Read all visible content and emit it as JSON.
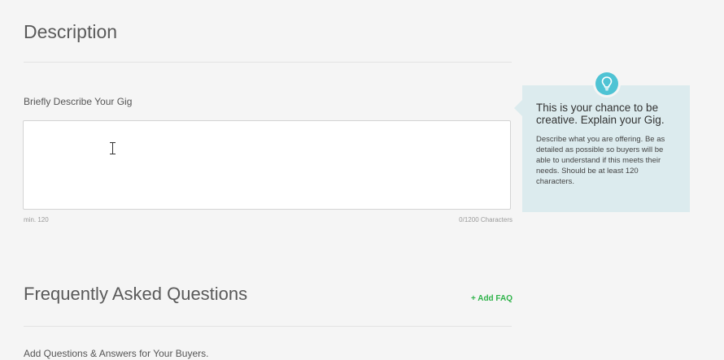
{
  "description": {
    "title": "Description",
    "field_label": "Briefly Describe Your Gig",
    "textarea_value": "",
    "min_label": "min. 120",
    "char_count": "0/1200 Characters"
  },
  "tip": {
    "icon": "lightbulb-icon",
    "heading": "This is your chance to be creative. Explain your Gig.",
    "body": "Describe what you are offering. Be as detailed as possible so buyers will be able to understand if this meets their needs. Should be at least 120 characters.",
    "accent_color": "#4fc3d4",
    "background_color": "#dcebee"
  },
  "faq": {
    "title": "Frequently Asked Questions",
    "add_label": "+ Add FAQ",
    "field_label": "Add Questions & Answers for Your Buyers."
  },
  "colors": {
    "link_green": "#2fb34a",
    "page_bg": "#f5f5f5"
  }
}
